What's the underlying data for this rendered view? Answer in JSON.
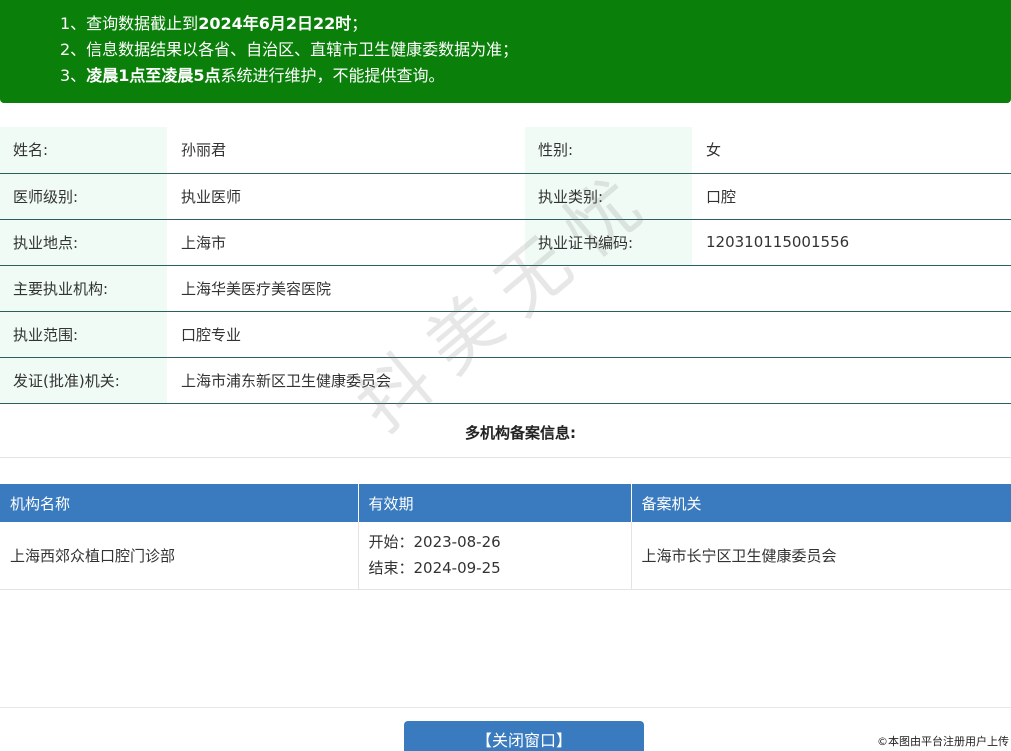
{
  "notice": {
    "lines": [
      {
        "prefix": "1、查询数据截止到",
        "bold": "2024年6月2日22时",
        "suffix": "；"
      },
      {
        "prefix": "2、信息数据结果以各省、自治区、直辖市卫生健康委数据为准；",
        "bold": "",
        "suffix": ""
      },
      {
        "prefix": "3、",
        "bold": "凌晨1点至凌晨5点",
        "suffix": "系统进行维护，不能提供查询。"
      }
    ]
  },
  "doctor": {
    "name_label": "姓名:",
    "name": "孙丽君",
    "gender_label": "性别:",
    "gender": "女",
    "level_label": "医师级别:",
    "level": "执业医师",
    "category_label": "执业类别:",
    "category": "口腔",
    "location_label": "执业地点:",
    "location": "上海市",
    "cert_label": "执业证书编码:",
    "cert": "120310115001556",
    "institution_label": "主要执业机构:",
    "institution": "上海华美医疗美容医院",
    "scope_label": "执业范围:",
    "scope": "口腔专业",
    "issuer_label": "发证(批准)机关:",
    "issuer": "上海市浦东新区卫生健康委员会"
  },
  "multi": {
    "title": "多机构备案信息:",
    "headers": [
      "机构名称",
      "有效期",
      "备案机关"
    ],
    "rows": [
      {
        "org": "上海西郊众植口腔门诊部",
        "start": "开始：2023-08-26",
        "end": "结束：2024-09-25",
        "authority": "上海市长宁区卫生健康委员会"
      }
    ]
  },
  "close_label": "【关闭窗口】",
  "watermark": "抖美无忧",
  "credit": "©本图由平台注册用户上传"
}
